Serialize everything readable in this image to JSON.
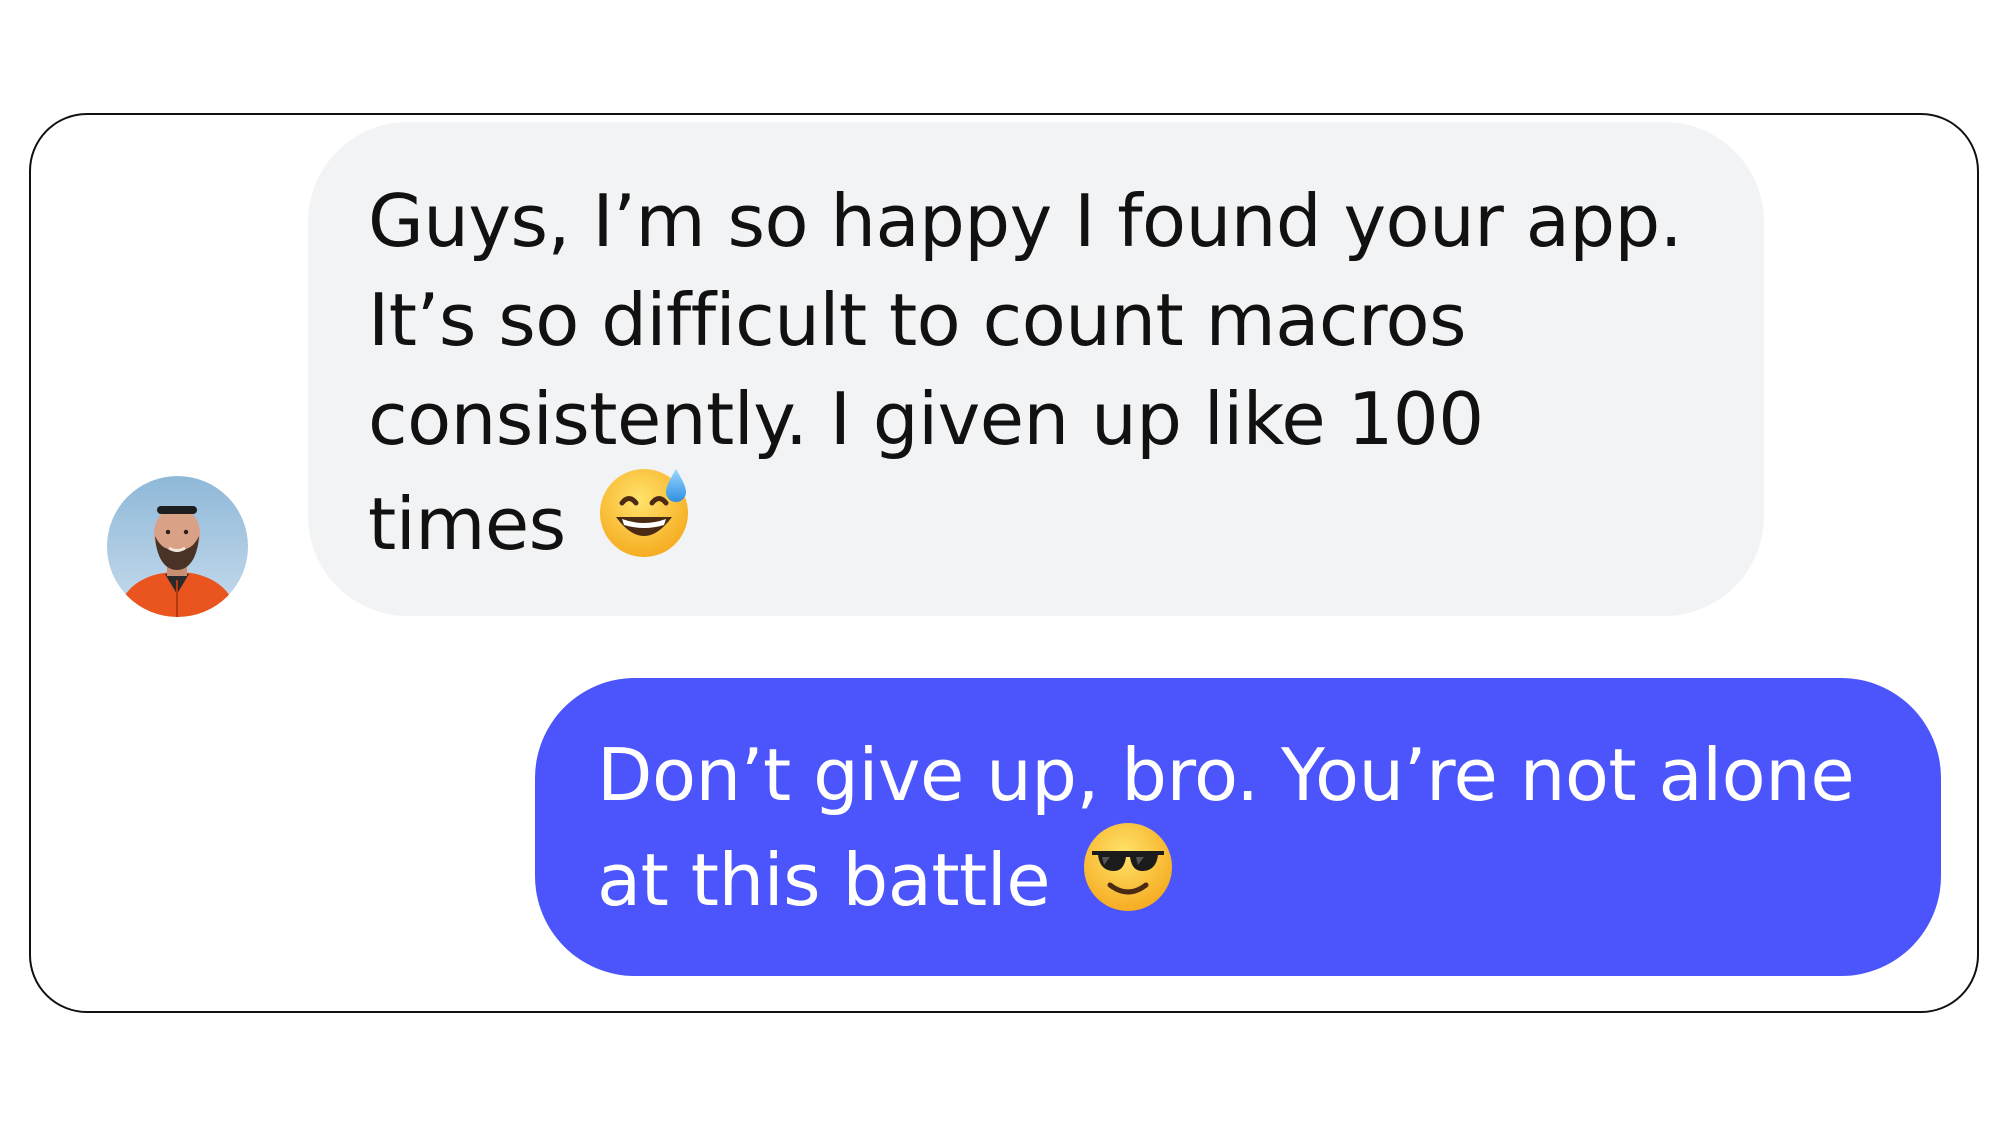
{
  "conversation": {
    "incoming": {
      "lines": [
        "Guys, I’m so happy I found your app.",
        "It’s so difficult to count macros",
        "consistently. I given up like 100",
        "times"
      ],
      "emoji": "grinning-face-with-sweat-icon"
    },
    "outgoing": {
      "lines": [
        "Don’t give up, bro. You’re not alone",
        "at this battle"
      ],
      "emoji": "smiling-face-with-sunglasses-icon"
    }
  },
  "colors": {
    "incoming_bubble": "#f2f3f5",
    "outgoing_bubble": "#4b55fb",
    "incoming_text": "#111111",
    "outgoing_text": "#ffffff",
    "frame_border": "#111111"
  }
}
